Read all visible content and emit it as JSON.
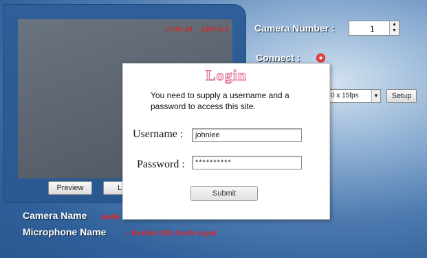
{
  "video": {
    "osd_time": "17:09:20",
    "osd_date": "2007/4/3"
  },
  "buttons": {
    "preview": "Preview",
    "live_partial": "L",
    "setup": "Setup"
  },
  "settings": {
    "camera_number_label": "Camera Number :",
    "camera_number_value": "1",
    "connect_label": "Connect :",
    "resolution_value": "0 x 15fps"
  },
  "info": {
    "camera_name_label": "Camera Name",
    "camera_name_value": "unde",
    "microphone_name_label": "Microphone Name",
    "microphone_name_value": ": Realtek HD Audio input"
  },
  "login": {
    "title": "Login",
    "message": "You need to supply a username and a password to access this site.",
    "username_label": "Username :",
    "username_value": "johnlee",
    "password_label": "Password :",
    "password_value": "**********",
    "submit_label": "Submit"
  },
  "colors": {
    "accent_red": "#e82020",
    "panel_blue": "#2f5f98"
  },
  "icons": {
    "connect": "connect-status-dot-icon",
    "spinner": "spinner-arrows-icon",
    "dropdown": "chevron-down-icon"
  }
}
